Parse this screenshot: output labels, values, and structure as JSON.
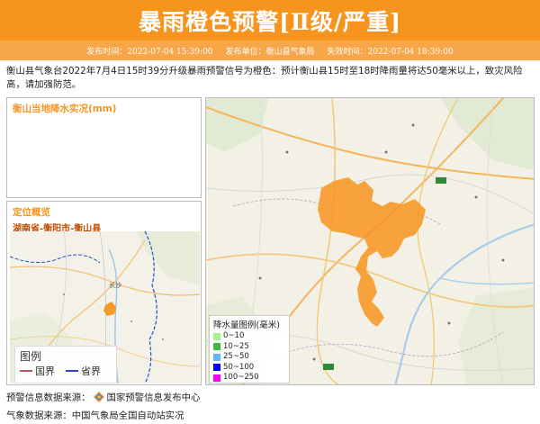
{
  "banner": {
    "title": "暴雨橙色预警[Ⅱ级/严重]"
  },
  "meta": {
    "publish_time": "发布时间：2022-07-04 15:39:00",
    "publisher": "发布单位：衡山县气象局",
    "expire_time": "失效时间：2022-07-04 18:39:00"
  },
  "description": "衡山县气象台2022年7月4日15时39分升级暴雨预警信号为橙色：预计衡山县15时至18时降雨量将达50毫米以上，致灾风险高，请加强防范。",
  "rain_panel": {
    "title": "衡山当地降水实况(mm)"
  },
  "locate_panel": {
    "title": "定位概览",
    "region": "湖南省-衡阳市-衡山县",
    "map_labels": {
      "changsha": "长沙"
    },
    "legend": {
      "title": "图例",
      "items": [
        {
          "label": "国界",
          "color": "#c0506a"
        },
        {
          "label": "省界",
          "color": "#1f4fc9"
        }
      ]
    }
  },
  "rain_legend": {
    "title": "降水量图例(毫米)",
    "items": [
      {
        "label": "0~10",
        "color": "#a6f28f"
      },
      {
        "label": "10~25",
        "color": "#3dba3d"
      },
      {
        "label": "25~50",
        "color": "#61b8ff"
      },
      {
        "label": "50~100",
        "color": "#0000fe"
      },
      {
        "label": "100~250",
        "color": "#fa00fa"
      }
    ]
  },
  "warning_color": "#f7941d",
  "sources": {
    "warning_source": "预警信息数据来源：",
    "warning_source_name": "国家预警信息发布中心",
    "weather_source": "气象数据来源：中国气象局全国自动站实况"
  }
}
